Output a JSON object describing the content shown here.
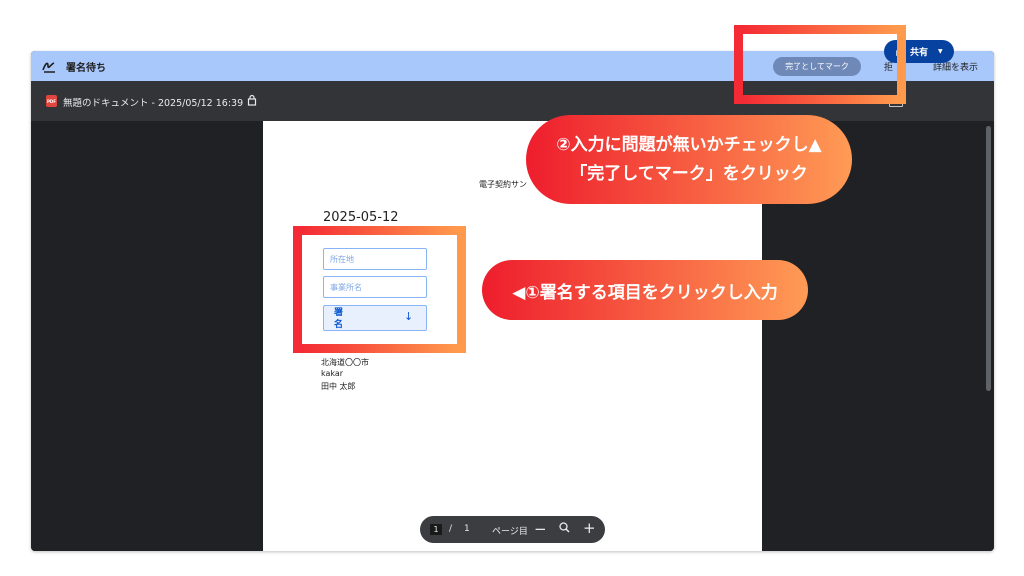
{
  "topbar": {
    "title": "署名待ち",
    "mark_complete_label": "完了としてマーク",
    "hidden_item_label": "拒",
    "details_label": "詳細を表示"
  },
  "docbar": {
    "pdf_badge": "PDF",
    "doc_title": "無題のドキュメント - 2025/05/12 16:39",
    "share_label": "共有"
  },
  "document": {
    "heading": "電子契約サン",
    "date": "2025-05-12",
    "fields": {
      "address_placeholder": "所在地",
      "office_placeholder": "事業所名",
      "signature_label": "署名"
    },
    "address_lines": [
      "北海道〇〇市",
      "kakar",
      "田中 太郎"
    ]
  },
  "pager": {
    "current_page": "1",
    "separator": "/",
    "total_pages": "1",
    "fit_label": "ページ目",
    "zoom_out": "−",
    "zoom_in": "+"
  },
  "annotations": {
    "step1": "◀①署名する項目をクリックし入力",
    "step2_line1": "②入力に問題が無いかチェックし▲",
    "step2_line2": "「完了してマーク」をクリック"
  },
  "colors": {
    "topbar": "#a8c7fa",
    "share": "#0842a0",
    "highlight_start": "#f42a34",
    "highlight_end": "#ff9a4d"
  }
}
